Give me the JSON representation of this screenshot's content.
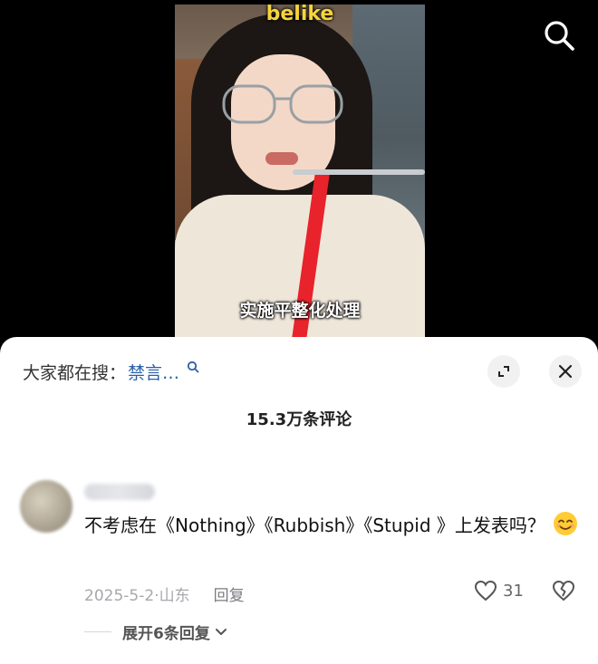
{
  "video": {
    "title_overlay": "belike",
    "subtitle": "实施平整化处理"
  },
  "top_bar": {
    "search_icon": "search-icon"
  },
  "comment_panel": {
    "trending_prefix": "大家都在搜：",
    "trending_keyword": "禁言…",
    "trending_icon": "search-small-icon",
    "expand_icon": "expand-icon",
    "close_icon": "close-icon",
    "comment_count": "15.3万条评论",
    "comments": [
      {
        "text": "不考虑在《Nothing》《Rubbish》《Stupid 》上发表吗？",
        "emoji_icon": "smiling-face-icon",
        "date_location": "2025-5-2·山东",
        "reply_label": "回复",
        "likes": "31",
        "like_icon": "heart-icon",
        "dislike_icon": "broken-heart-icon",
        "expand_replies": "展开6条回复",
        "expand_icon": "chevron-down-icon"
      }
    ]
  },
  "colors": {
    "title_yellow": "#f7d43b",
    "link_blue": "#2a5fa8",
    "muted_gray": "#a8a8ad"
  }
}
